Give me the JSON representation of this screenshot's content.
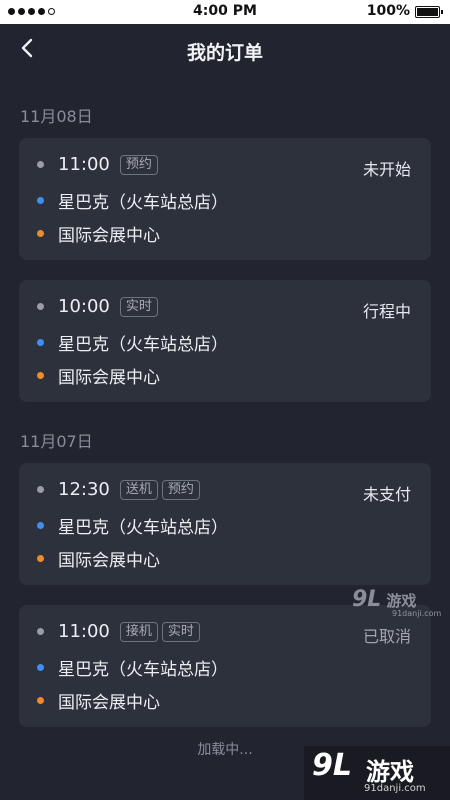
{
  "status_bar": {
    "carrier": "",
    "time": "4:00 PM",
    "battery_pct": "100%",
    "battery_level": 1.0
  },
  "nav": {
    "title": "我的订单",
    "back_icon": "chevron-left-icon"
  },
  "groups": [
    {
      "date": "11月08日"
    },
    {
      "date": "11月07日"
    }
  ],
  "orders": [
    {
      "time": "11:00",
      "tags": [
        "预约"
      ],
      "status": "未开始",
      "from": "星巴克（火车站总店）",
      "to": "国际会展中心"
    },
    {
      "time": "10:00",
      "tags": [
        "实时"
      ],
      "status": "行程中",
      "from": "星巴克（火车站总店）",
      "to": "国际会展中心"
    },
    {
      "time": "12:30",
      "tags": [
        "送机",
        "预约"
      ],
      "status": "未支付",
      "from": "星巴克（火车站总店）",
      "to": "国际会展中心"
    },
    {
      "time": "11:00",
      "tags": [
        "接机",
        "实时"
      ],
      "status": "已取消",
      "from": "星巴克（火车站总店）",
      "to": "国际会展中心"
    }
  ],
  "loading_text": "加载中...",
  "watermark": {
    "logo": "9L",
    "brand": "游戏",
    "site": "91danji.com"
  },
  "colors": {
    "background": "#222530",
    "card": "#2d313c",
    "start_dot": "#3f8ef2",
    "end_dot": "#f08a2c",
    "time_dot": "#9a9ca6"
  }
}
